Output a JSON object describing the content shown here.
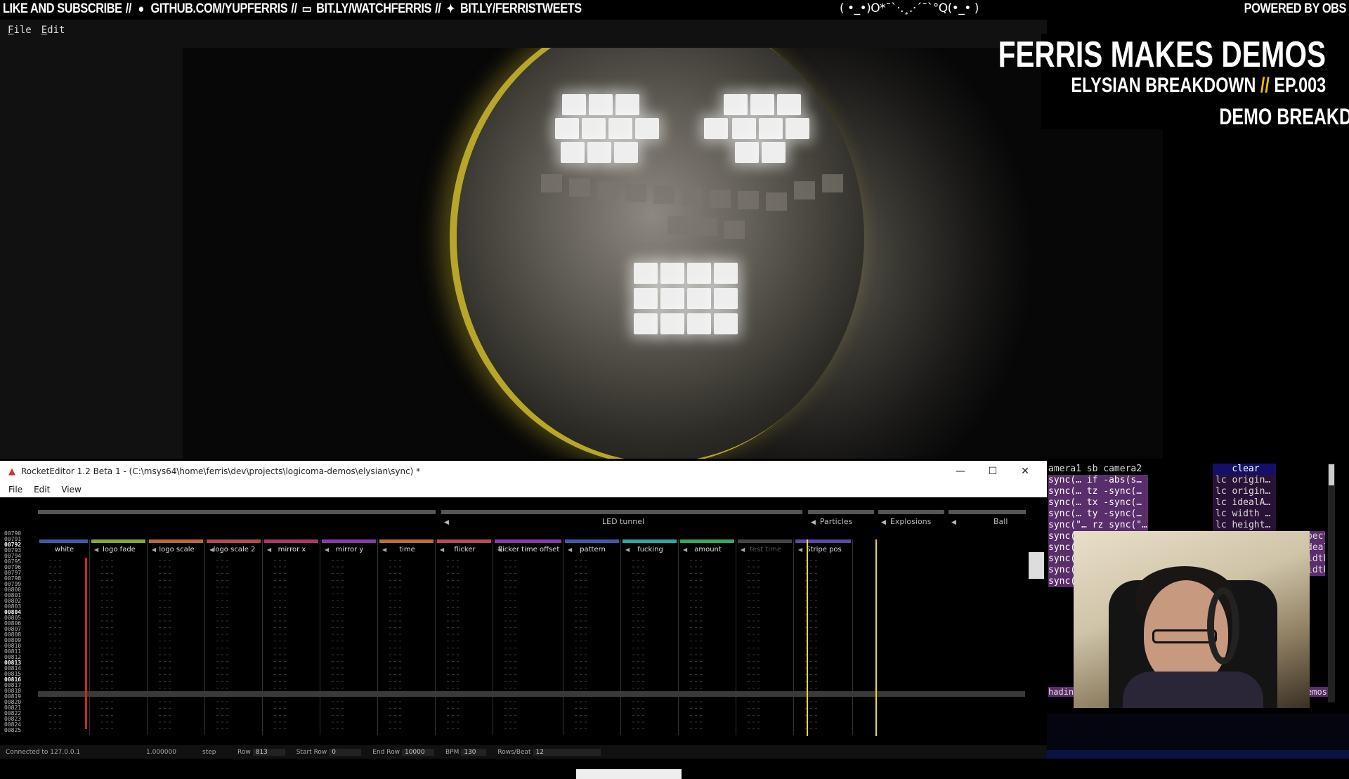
{
  "banner": {
    "like": "LIKE AND SUBSCRIBE",
    "sep": "//",
    "github": "GITHUB.COM/YUPFERRIS",
    "twitch": "BIT.LY/WATCHFERRIS",
    "twitter": "BIT.LY/FERRISTWEETS",
    "emote": "( •_•)O*¯`·.¸.·´¯`°Q(•_• )",
    "powered": "POWERED BY OBS"
  },
  "player": {
    "menu": [
      "File",
      "Edit"
    ]
  },
  "overlay": {
    "title": "FERRIS MAKES DEMOS",
    "subtitle_left": "ELYSIAN BREAKDOWN",
    "subtitle_sep": "//",
    "subtitle_right": "EP.003",
    "tag": "DEMO BREAKDOWN"
  },
  "rocket": {
    "title": "RocketEditor 1.2 Beta 1 - (C:\\msys64\\home\\ferris\\dev\\projects\\logicoma-demos\\elysian\\sync) *",
    "menu": [
      "File",
      "Edit",
      "View"
    ],
    "controls": {
      "minimize": "—",
      "maximize": "☐",
      "close": "✕"
    },
    "groups": {
      "led": "LED tunnel",
      "particles": "Particles",
      "explosions": "Explosions",
      "ball": "Ball"
    },
    "tracks": [
      {
        "name": "white",
        "color": "#3a5fa8"
      },
      {
        "name": "logo fade",
        "color": "#86a83a"
      },
      {
        "name": "logo scale",
        "color": "#b86a3a"
      },
      {
        "name": "logo scale 2",
        "color": "#b84a4a"
      },
      {
        "name": "mirror x",
        "color": "#a83a6a"
      },
      {
        "name": "mirror y",
        "color": "#8a3aa8"
      },
      {
        "name": "time",
        "color": "#b8703a"
      },
      {
        "name": "flicker",
        "color": "#b84a5a"
      },
      {
        "name": "flicker time offset",
        "color": "#8a3aa8"
      },
      {
        "name": "pattern",
        "color": "#3a5fa8"
      },
      {
        "name": "fucking",
        "color": "#2aa8a8"
      },
      {
        "name": "amount",
        "color": "#3aa85a"
      },
      {
        "name": "test time",
        "color": "#444444"
      },
      {
        "name": "Stripe pos",
        "color": "#5a4aa8"
      }
    ],
    "row_numbers": [
      "00790",
      "00791",
      "00792",
      "00793",
      "00794",
      "00795",
      "00796",
      "00797",
      "00798",
      "00799",
      "00800",
      "00801",
      "00802",
      "00803",
      "00804",
      "00805",
      "00806",
      "00807",
      "00808",
      "00809",
      "00810",
      "00811",
      "00812",
      "00813",
      "00814",
      "00815",
      "00816",
      "00817",
      "00818",
      "00819",
      "00820",
      "00821",
      "00822",
      "00823",
      "00824",
      "00825"
    ],
    "status": {
      "connected": "Connected to 127.0.0.1",
      "value": "1.000000",
      "step": "step",
      "row_label": "Row",
      "row": "813",
      "start_label": "Start Row",
      "start": "0",
      "end_label": "End Row",
      "end": "10000",
      "bpm_label": "BPM",
      "bpm": "130",
      "rpb_label": "Rows/Beat",
      "rpb": "12"
    }
  },
  "debug": {
    "col1": [
      "amera1 sb camera2",
      "sync(… if -abs(s…",
      "sync(… tz -sync(…",
      "sync(… tx -sync(…",
      "sync(… ty -sync(…",
      "sync(\"… rz sync(\"…",
      "sync(\"",
      "sync(\"",
      "sync(",
      "sync(",
      "sync("
    ],
    "col2": [
      "clear",
      "lc origin…",
      "lc origin…",
      "lc idealA…",
      "lc width …",
      "lc height…"
    ],
    "right": [
      "pect",
      "dealA",
      "idth",
      "idth"
    ],
    "bottom_left": "hadin",
    "bottom_right": "emos"
  },
  "colors": {
    "accent_yellow": "#f2c200",
    "selection": "#e8dc2a",
    "debug_magenta": "#5a2d6b",
    "debug_selected": "#14106a"
  }
}
